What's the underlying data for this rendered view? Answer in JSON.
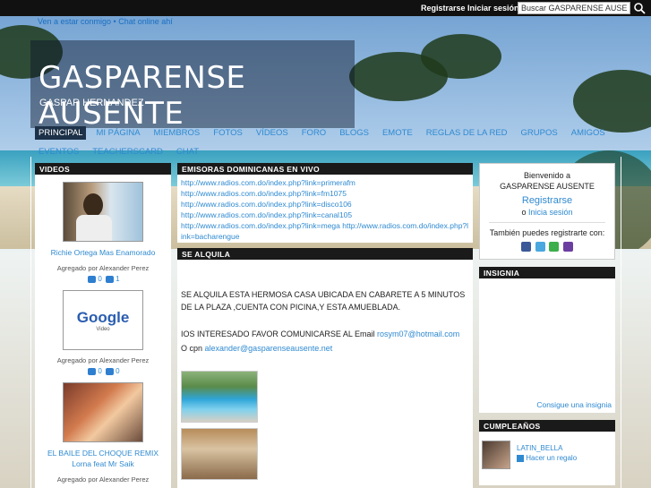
{
  "topbar": {
    "register": "Registrarse",
    "login": "Iniciar sesión",
    "search_value": "Buscar GASPARENSE AUSENTE"
  },
  "promo": "Ven a estar conmigo • Chat online ahí",
  "header": {
    "title": "GASPARENSE AUSENTE",
    "subtitle": "GASPAR HERNANDEZ"
  },
  "nav": [
    "PRINCIPAL",
    "MI PÁGINA",
    "MIEMBROS",
    "FOTOS",
    "VÍDEOS",
    "FORO",
    "BLOGS",
    "EMOTE",
    "REGLAS DE LA RED",
    "GRUPOS",
    "AMIGOS",
    "EVENTOS",
    "TEACHERSCARD",
    "CHAT"
  ],
  "videos": {
    "heading": "VIDEOS",
    "items": [
      {
        "title": "Richie Ortega Mas Enamorado",
        "added_by": "Agregado por Alexander Perez",
        "comments": "0",
        "likes": "1"
      },
      {
        "title": "",
        "added_by": "Agregado por Alexander Perez",
        "comments": "0",
        "likes": "0",
        "thumb_text": "Google",
        "thumb_sub": "Video"
      },
      {
        "title": "EL BAILE DEL CHOQUE REMIX Lorna feat Mr Saik",
        "added_by": "Agregado por Alexander Perez"
      }
    ]
  },
  "emisoras": {
    "heading": "EMISORAS DOMINICANAS EN VIVO",
    "links": [
      "http://www.radios.com.do/index.php?link=primerafm",
      "http://www.radios.com.do/index.php?link=fm1075",
      "http://www.radios.com.do/index.php?link=disco106",
      "http://www.radios.com.do/index.php?link=canal105",
      "http://www.radios.com.do/index.php?link=mega http://www.radios.com.do/index.php?link=bacharengue"
    ]
  },
  "alquila": {
    "heading": "SE ALQUILA",
    "paragraph1": "SE ALQUILA ESTA HERMOSA CASA UBICADA EN CABARETE A 5 MINUTOS DE LA PLAZA ,CUENTA CON PICINA,Y ESTA AMUEBLADA.",
    "paragraph2": "IOS INTERESADO FAVOR COMUNICARSE AL Email ",
    "email1": "rosym07@hotmail.com",
    "paragraph3": "O cpn ",
    "email2": "alexander@gasparenseausente.net"
  },
  "welcome": {
    "line1": "Bienvenido a",
    "line2": "GASPARENSE AUSENTE",
    "register": "Registrarse",
    "or": "o",
    "login": "Inicia sesión",
    "also": "También puedes registrarte con:"
  },
  "insignia": {
    "heading": "INSIGNIA",
    "link": "Consigue una insignia"
  },
  "cumpleanos": {
    "heading": "CUMPLEAÑOS",
    "name": "LATIN_BELLA",
    "gift": "Hacer un regalo"
  }
}
